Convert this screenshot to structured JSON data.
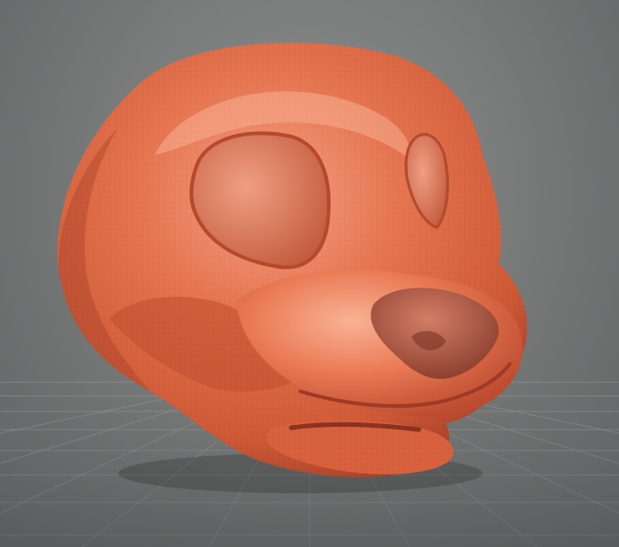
{
  "viewport": {
    "background_color": "#7a7d7c",
    "grid_color": "#9a9d9c",
    "grid_visible": true
  },
  "model": {
    "name_icon": "animal-head-mask-icon",
    "base_color": "#e06a45",
    "highlight_color": "#f4a387",
    "shadow_color": "#a9412a",
    "nose_color": "#b9614a",
    "wireframe_visible": true
  }
}
